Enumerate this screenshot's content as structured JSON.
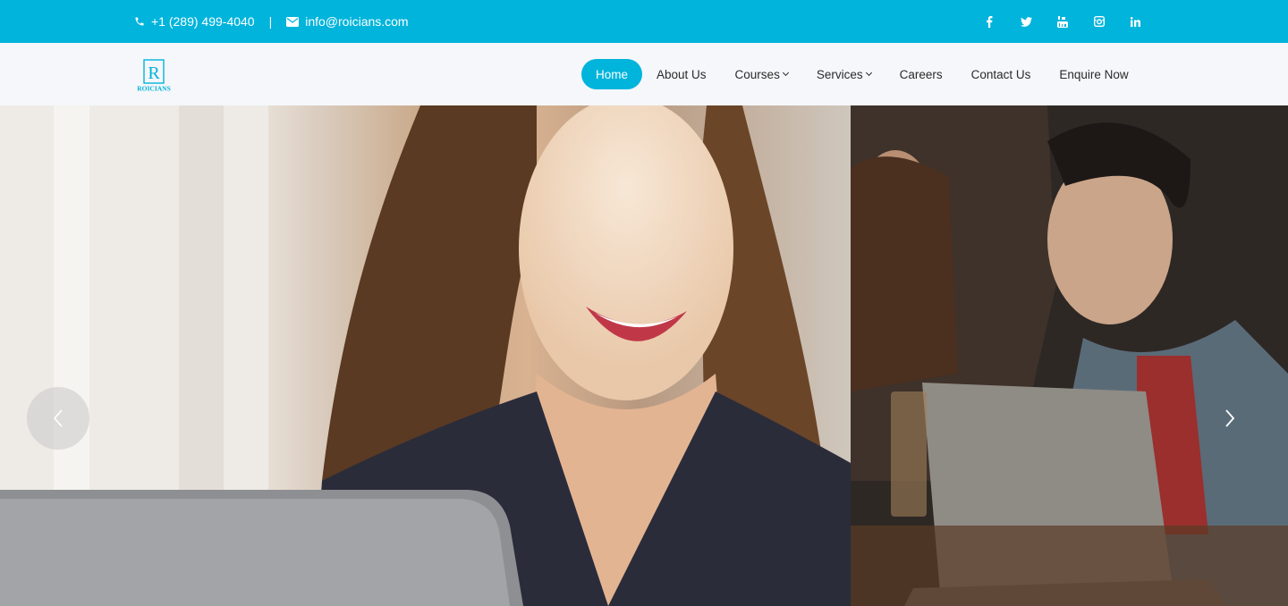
{
  "topbar": {
    "phone": "+1 (289) 499-4040",
    "separator": "|",
    "email": "info@roicians.com",
    "social": [
      {
        "icon": "facebook-icon",
        "glyph": "f"
      },
      {
        "icon": "twitter-icon",
        "glyph": ""
      },
      {
        "icon": "youtube-icon",
        "glyph": ""
      },
      {
        "icon": "instagram-icon",
        "glyph": ""
      },
      {
        "icon": "linkedin-icon",
        "glyph": "in"
      }
    ]
  },
  "logo": {
    "text": "ROICIANS",
    "mark": "R"
  },
  "nav": {
    "items": [
      {
        "label": "Home",
        "active": true
      },
      {
        "label": "About Us"
      },
      {
        "label": "Courses",
        "dropdown": true
      },
      {
        "label": "Services",
        "dropdown": true
      },
      {
        "label": "Careers"
      },
      {
        "label": "Contact Us"
      },
      {
        "label": "Enquire Now"
      }
    ]
  },
  "colors": {
    "accent": "#00b4dc",
    "nav_bg": "#f5f7fa",
    "text": "#2a2a2a"
  },
  "hero": {
    "slides": [
      {
        "alt": "woman-laughing-at-laptop"
      },
      {
        "alt": "two-people-laughing-with-laptop"
      }
    ],
    "prev_icon": "chevron-left-icon",
    "next_icon": "chevron-right-icon"
  }
}
